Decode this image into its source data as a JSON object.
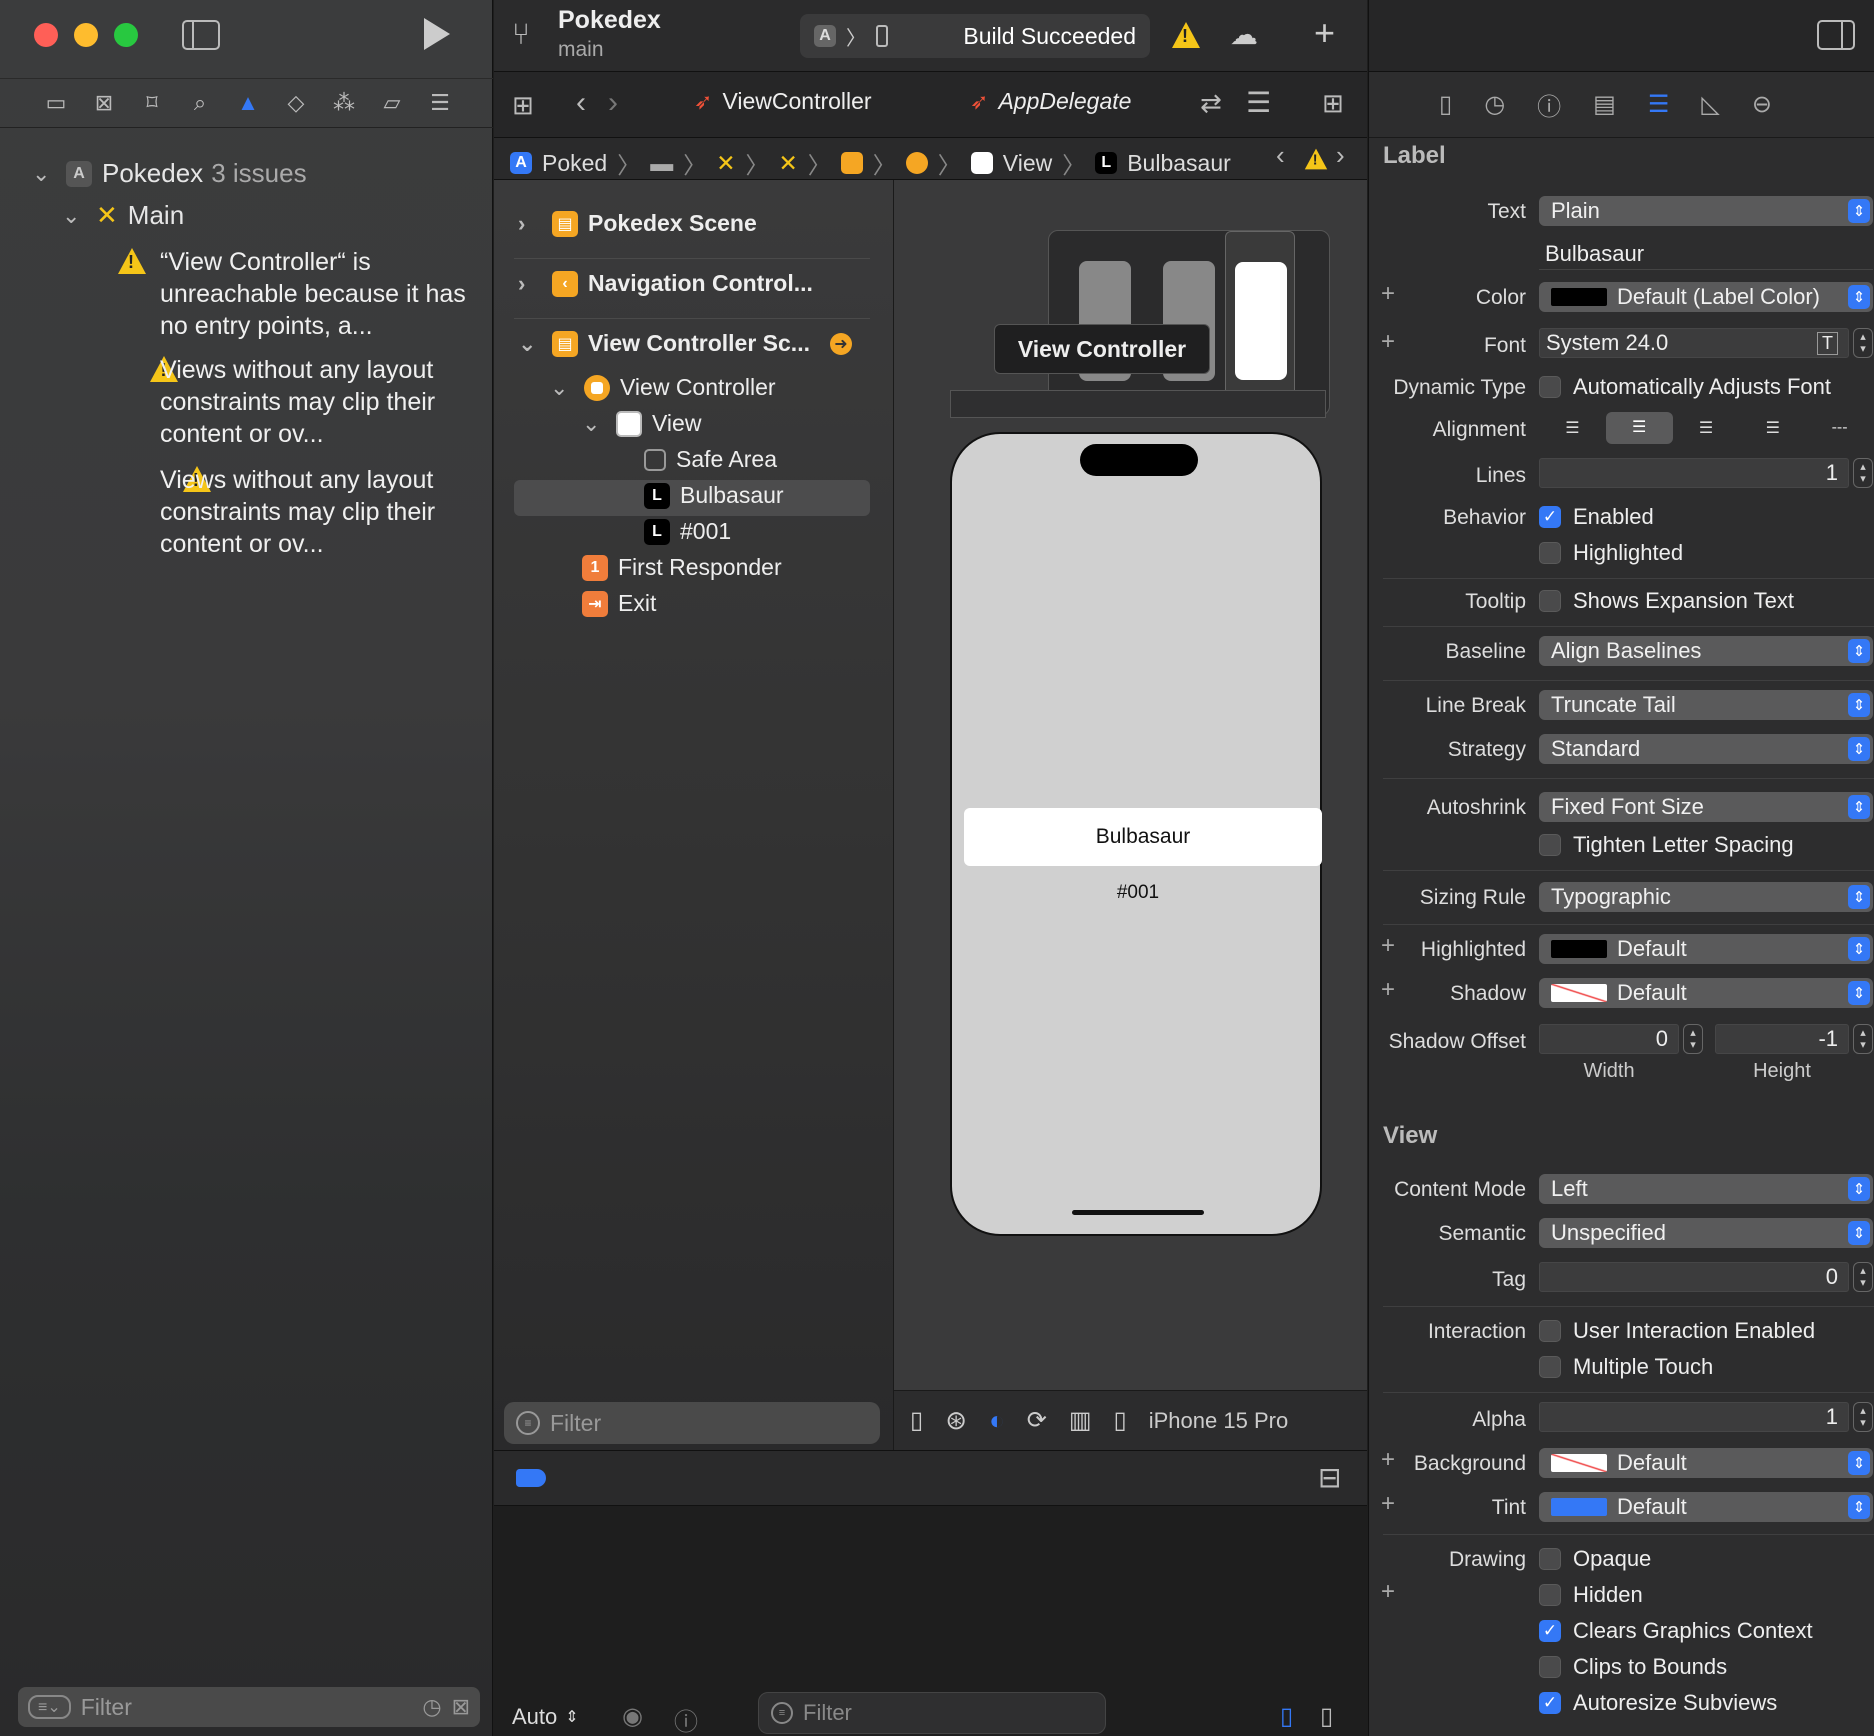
{
  "toolbar": {
    "project_name": "Pokedex",
    "branch": "main",
    "build_status": "Build Succeeded"
  },
  "tabs": [
    {
      "label": "ViewController"
    },
    {
      "label": "AppDelegate"
    }
  ],
  "jumpbar": {
    "items": [
      "Poked",
      "View",
      "Bulbasaur"
    ]
  },
  "navigator": {
    "project": "Pokedex",
    "issue_count": "3 issues",
    "group": "Main",
    "issues": [
      "“View Controller“ is unreachable because it has no entry points, a...",
      "Views without any layout constraints may clip their content or ov...",
      "Views without any layout constraints may clip their content or ov..."
    ],
    "filter_placeholder": "Filter"
  },
  "outline": {
    "rows": [
      {
        "label": "Pokedex Scene"
      },
      {
        "label": "Navigation Control..."
      },
      {
        "label": "View Controller Sc..."
      },
      {
        "label": "View Controller"
      },
      {
        "label": "View"
      },
      {
        "label": "Safe Area"
      },
      {
        "label": "Bulbasaur"
      },
      {
        "label": "#001"
      },
      {
        "label": "First Responder"
      },
      {
        "label": "Exit"
      }
    ],
    "filter_placeholder": "Filter"
  },
  "canvas": {
    "tooltip": "View Controller",
    "label_name": "Bulbasaur",
    "label_number": "#001",
    "device": "iPhone 15 Pro"
  },
  "debug": {
    "auto_label": "Auto",
    "filter_placeholder": "Filter"
  },
  "inspector": {
    "label_section": "Label",
    "view_section": "View",
    "text_label": "Text",
    "text_value": "Plain",
    "text_content": "Bulbasaur",
    "color_label": "Color",
    "color_value": "Default (Label Color)",
    "font_label": "Font",
    "font_value": "System 24.0",
    "dynamic_type_label": "Dynamic Type",
    "dynamic_type_value": "Automatically Adjusts Font",
    "alignment_label": "Alignment",
    "lines_label": "Lines",
    "lines_value": "1",
    "behavior_label": "Behavior",
    "enabled": "Enabled",
    "highlighted": "Highlighted",
    "tooltip_label": "Tooltip",
    "tooltip_value": "Shows Expansion Text",
    "baseline_label": "Baseline",
    "baseline_value": "Align Baselines",
    "line_break_label": "Line Break",
    "line_break_value": "Truncate Tail",
    "strategy_label": "Strategy",
    "strategy_value": "Standard",
    "autoshrink_label": "Autoshrink",
    "autoshrink_value": "Fixed Font Size",
    "tighten_value": "Tighten Letter Spacing",
    "sizing_rule_label": "Sizing Rule",
    "sizing_rule_value": "Typographic",
    "highlighted_label": "Highlighted",
    "highlighted_value": "Default",
    "shadow_label": "Shadow",
    "shadow_value": "Default",
    "shadow_offset_label": "Shadow Offset",
    "shadow_width_value": "0",
    "shadow_height_value": "-1",
    "width_caption": "Width",
    "height_caption": "Height",
    "content_mode_label": "Content Mode",
    "content_mode_value": "Left",
    "semantic_label": "Semantic",
    "semantic_value": "Unspecified",
    "tag_label": "Tag",
    "tag_value": "0",
    "interaction_label": "Interaction",
    "user_interaction_value": "User Interaction Enabled",
    "multiple_touch_value": "Multiple Touch",
    "alpha_label": "Alpha",
    "alpha_value": "1",
    "background_label": "Background",
    "background_value": "Default",
    "tint_label": "Tint",
    "tint_value": "Default",
    "drawing_label": "Drawing",
    "opaque": "Opaque",
    "hidden": "Hidden",
    "clears_graphics": "Clears Graphics Context",
    "clips_bounds": "Clips to Bounds",
    "autoresize": "Autoresize Subviews"
  },
  "colors": {
    "accent": "#3478f6",
    "warning": "#f5c518",
    "swift": "#f05138"
  }
}
